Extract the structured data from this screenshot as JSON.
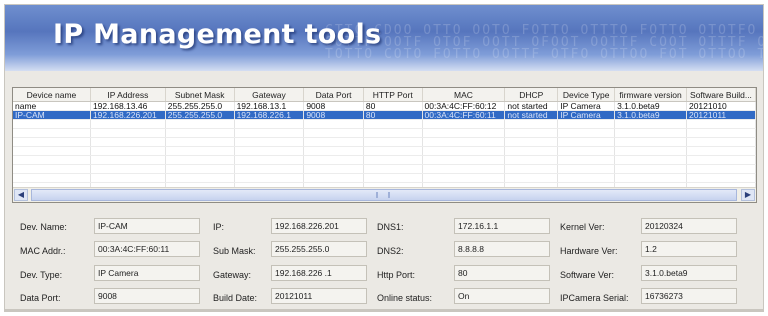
{
  "app": {
    "title": "IP Management tools",
    "banner_pattern": "CTTC CDOO OTTO OOTO FOTTO OTTTO FOTTO OTOTFO OOO\nOOTTF OOTF OTOF OOTT OFOOT OOTTF COOT OTTTF OOOT\nTOTTO COTO FOTTO OOTTF OTFO OTTOO FOT OTTOO TOO"
  },
  "grid": {
    "columns": [
      "Device name",
      "IP Address",
      "Subnet Mask",
      "Gateway",
      "Data Port",
      "HTTP Port",
      "MAC",
      "DHCP",
      "Device Type",
      "firmware version",
      "Software Build..."
    ],
    "rows": [
      [
        "name",
        "192.168.13.46",
        "255.255.255.0",
        "192.168.13.1",
        "9008",
        "80",
        "00:3A:4C:FF:60:12",
        "not started",
        "IP Camera",
        "3.1.0.beta9",
        "20121010"
      ],
      [
        "IP-CAM",
        "192.168.226.201",
        "255.255.255.0",
        "192.168.226.1",
        "9008",
        "80",
        "00:3A:4C:FF:60:11",
        "not started",
        "IP Camera",
        "3.1.0.beta9",
        "20121011"
      ]
    ],
    "selected_row": 1,
    "colors": {
      "selection": "#316ac5"
    }
  },
  "details": {
    "dev_name": {
      "label": "Dev. Name:",
      "value": "IP-CAM"
    },
    "mac_addr": {
      "label": "MAC Addr.:",
      "value": "00:3A:4C:FF:60:11"
    },
    "dev_type": {
      "label": "Dev. Type:",
      "value": "IP Camera"
    },
    "data_port": {
      "label": "Data Port:",
      "value": "9008"
    },
    "ip": {
      "label": "IP:",
      "value": "192.168.226.201"
    },
    "sub_mask": {
      "label": "Sub Mask:",
      "value": "255.255.255.0"
    },
    "gateway": {
      "label": "Gateway:",
      "value": "192.168.226 .1"
    },
    "build_date": {
      "label": "Build Date:",
      "value": "20121011"
    },
    "dns1": {
      "label": "DNS1:",
      "value": "172.16.1.1"
    },
    "dns2": {
      "label": "DNS2:",
      "value": "8.8.8.8"
    },
    "http_port": {
      "label": "Http Port:",
      "value": "80"
    },
    "online_status": {
      "label": "Online status:",
      "value": "On"
    },
    "kernel_ver": {
      "label": "Kernel Ver:",
      "value": "20120324"
    },
    "hardware_ver": {
      "label": "Hardware Ver:",
      "value": "1.2"
    },
    "software_ver": {
      "label": "Software Ver:",
      "value": "3.1.0.beta9"
    },
    "ipcamera_serial": {
      "label": "IPCamera Serial:",
      "value": "16736273"
    }
  },
  "scrollbar": {
    "left_icon": "arrow-left-icon",
    "right_icon": "arrow-right-icon"
  }
}
